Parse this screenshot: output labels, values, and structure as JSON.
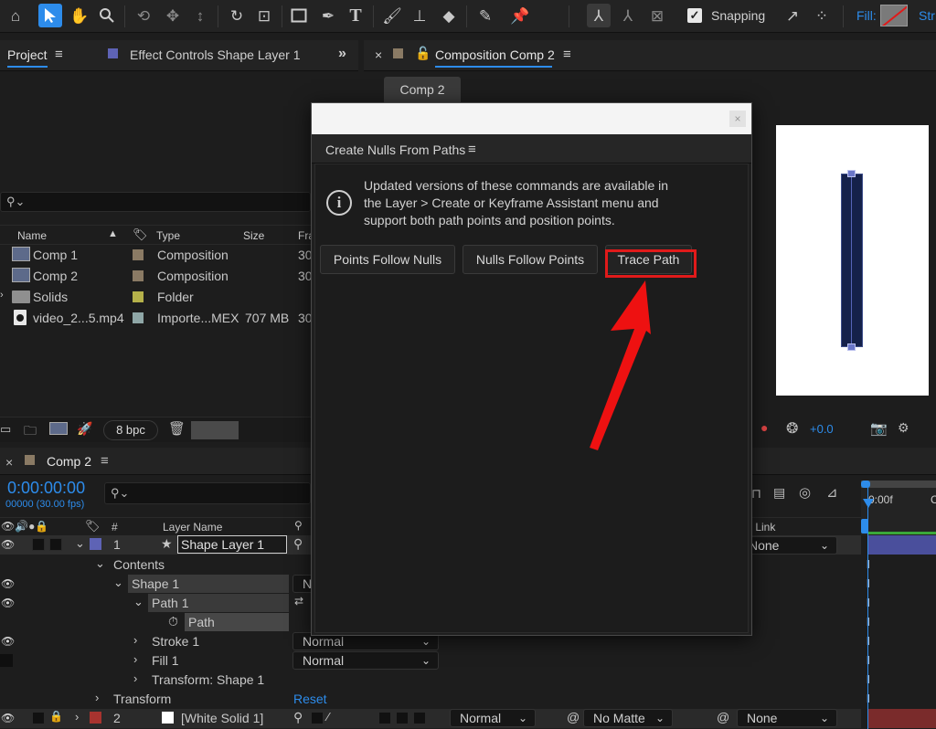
{
  "toolbar": {
    "snapping_label": "Snapping",
    "snapping_checked": true,
    "fill_label": "Fill:",
    "stroke_label": "Str",
    "tools": [
      "home-icon",
      "selection-tool-icon",
      "hand-tool-icon",
      "zoom-tool-icon",
      "orbit-camera-icon",
      "pan-camera-icon",
      "dolly-camera-icon",
      "rotate-tool-icon",
      "anchor-point-tool-icon",
      "rectangle-tool-icon",
      "pen-tool-icon",
      "type-tool-icon",
      "brush-tool-icon",
      "clone-stamp-icon",
      "eraser-icon",
      "roto-brush-icon",
      "puppet-pin-icon"
    ]
  },
  "project_panel": {
    "tab_label": "Project",
    "effect_controls_label": "Effect Controls Shape Layer 1",
    "columns": {
      "name": "Name",
      "type": "Type",
      "size": "Size",
      "frame": "Fra"
    },
    "items": [
      {
        "name": "Comp 1",
        "type": "Composition",
        "size": "",
        "frame": "30",
        "label_color": "#8a7a64",
        "icon": "composition-icon"
      },
      {
        "name": "Comp 2",
        "type": "Composition",
        "size": "",
        "frame": "30",
        "label_color": "#8a7a64",
        "icon": "composition-icon"
      },
      {
        "name": "Solids",
        "type": "Folder",
        "size": "",
        "frame": "",
        "label_color": "#b5b14a",
        "icon": "folder-icon"
      },
      {
        "name": "video_2...5.mp4",
        "type": "Importe...MEX",
        "size": "707 MB",
        "frame": "30",
        "label_color": "#8fa7a7",
        "icon": "video-file-icon"
      }
    ],
    "bpc_label": "8 bpc"
  },
  "composition_panel": {
    "tab_label": "Composition Comp 2",
    "comp_tab": "Comp 2",
    "exposure_value": "+0.0"
  },
  "dialog": {
    "title": "Create Nulls From Paths",
    "info_text": "Updated versions of these commands are available in the Layer > Create or Keyframe Assistant menu and support both path points and position points.",
    "buttons": [
      "Points Follow Nulls",
      "Nulls Follow Points",
      "Trace Path"
    ]
  },
  "timeline": {
    "tab_label": "Comp 2",
    "timecode": "0:00:00:00",
    "frame_info": "00000 (30.00 fps)",
    "col_num": "#",
    "col_layer_name": "Layer Name",
    "col_parent": "k Link",
    "ruler_start": "0:00f",
    "ruler_next": "C",
    "layers": [
      {
        "num": "1",
        "name": "Shape Layer 1",
        "label_color": "#5e63b5",
        "parent": "None"
      },
      {
        "num": "2",
        "name": "[White Solid 1]",
        "label_color": "#a8332f",
        "mode": "Normal",
        "matte": "No Matte",
        "parent": "None"
      }
    ],
    "props": {
      "contents": "Contents",
      "shape1": "Shape 1",
      "shape1_mode": "N",
      "path1": "Path 1",
      "path": "Path",
      "stroke1": "Stroke 1",
      "stroke_mode": "Normal",
      "fill1": "Fill 1",
      "fill_mode": "Normal",
      "transform_shape": "Transform: Shape 1",
      "transform": "Transform",
      "reset": "Reset"
    }
  },
  "colors": {
    "accent": "#2d8ceb",
    "highlight_box": "#e01a1a",
    "arrow": "#ee1111",
    "shape_fill": "#15214a"
  }
}
